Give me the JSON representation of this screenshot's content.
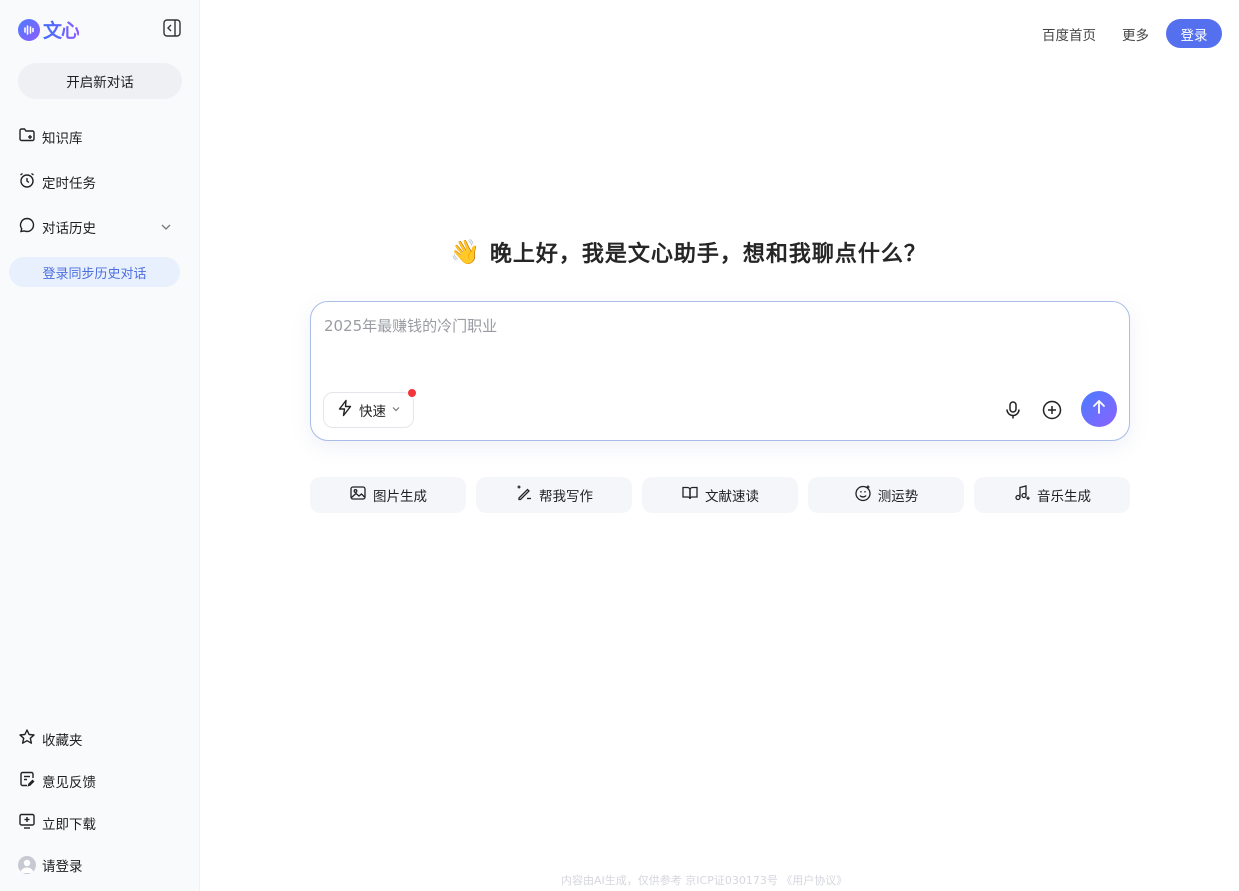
{
  "sidebar": {
    "logo_text": "文心",
    "new_chat_label": "开启新对话",
    "items": [
      {
        "label": "知识库",
        "icon": "folder-plus-icon"
      },
      {
        "label": "定时任务",
        "icon": "alarm-clock-icon"
      },
      {
        "label": "对话历史",
        "icon": "chat-bubble-icon"
      }
    ],
    "sync_history_label": "登录同步历史对话",
    "bottom_items": [
      {
        "label": "收藏夹",
        "icon": "star-icon"
      },
      {
        "label": "意见反馈",
        "icon": "feedback-icon"
      },
      {
        "label": "立即下载",
        "icon": "download-monitor-icon"
      },
      {
        "label": "请登录",
        "icon": "avatar-icon"
      }
    ]
  },
  "header": {
    "links": [
      "百度首页",
      "更多"
    ],
    "login_label": "登录"
  },
  "main": {
    "greeting_emoji": "👋",
    "greeting": "晚上好，我是文心助手，想和我聊点什么？",
    "input_placeholder": "2025年最赚钱的冷门职业",
    "mode_label": "快速",
    "chips": [
      {
        "label": "图片生成",
        "icon": "image-icon"
      },
      {
        "label": "帮我写作",
        "icon": "pen-sparkle-icon"
      },
      {
        "label": "文献速读",
        "icon": "book-icon"
      },
      {
        "label": "测运势",
        "icon": "fortune-face-icon"
      },
      {
        "label": "音乐生成",
        "icon": "music-note-icon"
      }
    ]
  },
  "footer": {
    "text": "内容由AI生成，仅供参考  京ICP证030173号  《用户协议》"
  },
  "colors": {
    "accent": "#5470ef",
    "sidebar_bg": "#f9fafc",
    "sync_bg": "#e8f0fd",
    "sync_text": "#4c6ee0"
  }
}
